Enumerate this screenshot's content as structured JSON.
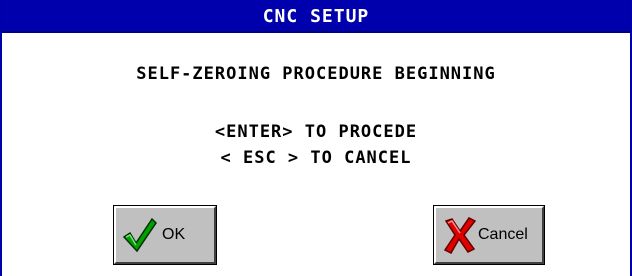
{
  "window": {
    "title": "CNC SETUP"
  },
  "message": {
    "main": "SELF-ZEROING PROCEDURE BEGINNING",
    "enter_hint": "<ENTER> TO PROCEDE",
    "esc_hint": "< ESC > TO CANCEL"
  },
  "buttons": {
    "ok": {
      "label": "OK",
      "icon": "checkmark-icon"
    },
    "cancel": {
      "label": "Cancel",
      "icon": "x-mark-icon"
    }
  },
  "colors": {
    "titlebar": "#0000ad",
    "check_green": "#00a000",
    "x_red": "#e00000",
    "button_face": "#c0c0c0"
  }
}
